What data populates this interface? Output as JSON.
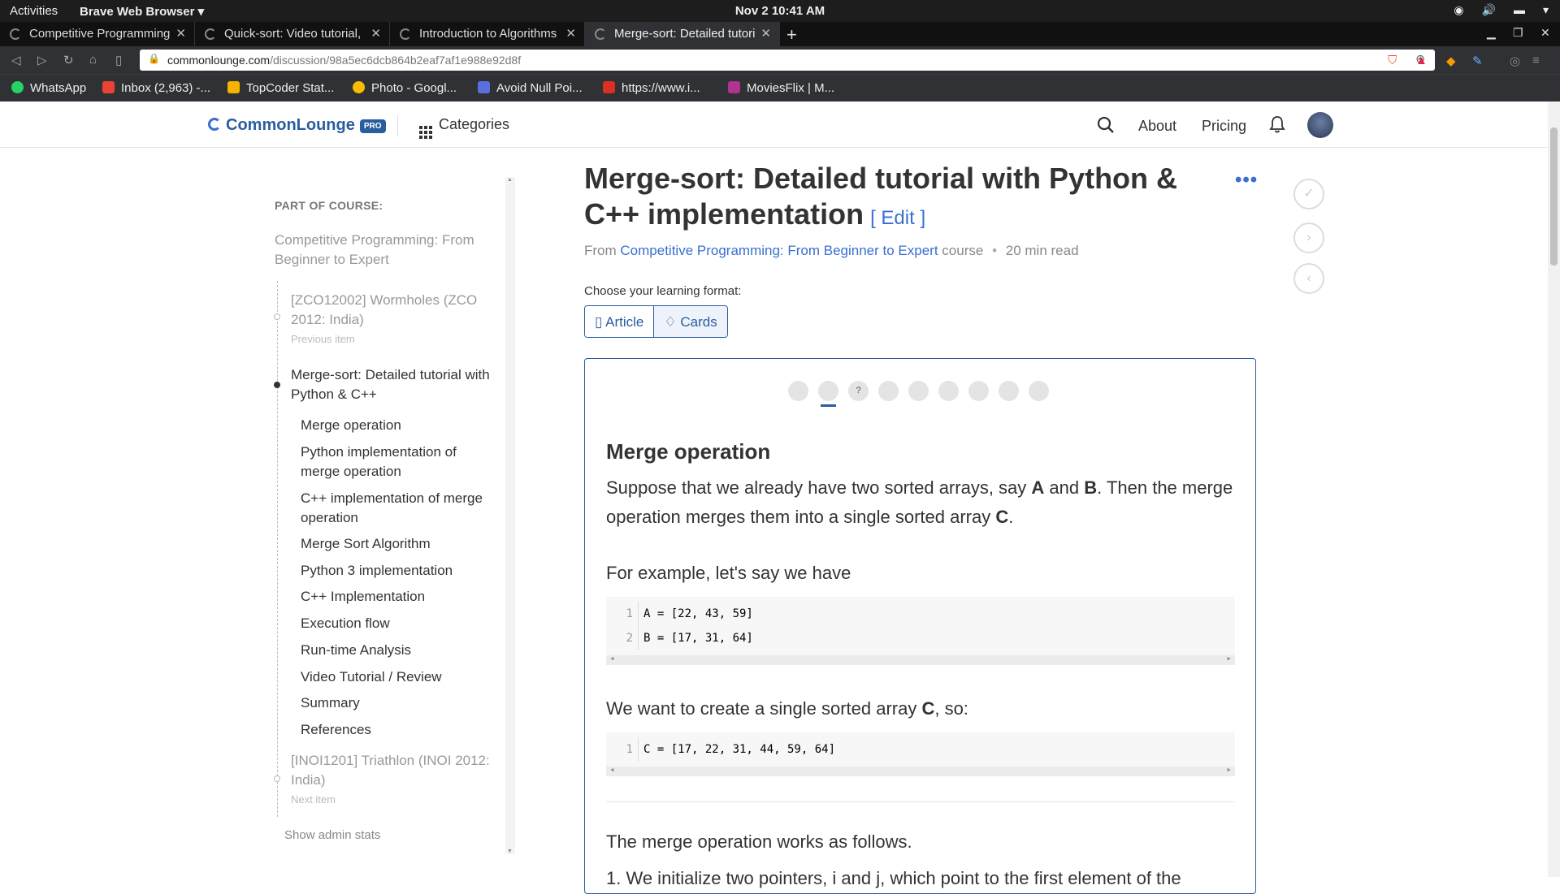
{
  "system": {
    "activities": "Activities",
    "app_menu": "Brave Web Browser ▾",
    "clock": "Nov 2  10:41 AM"
  },
  "tabs": [
    {
      "label": "Competitive Programming"
    },
    {
      "label": "Quick-sort: Video tutorial,"
    },
    {
      "label": "Introduction to Algorithms"
    },
    {
      "label": "Merge-sort: Detailed tutori"
    }
  ],
  "address_bar": {
    "url_domain": "commonlounge.com",
    "url_path": "/discussion/98a5ec6dcb864b2eaf7af1e988e92d8f"
  },
  "bookmarks": [
    {
      "label": "WhatsApp",
      "color": "#25d366"
    },
    {
      "label": "Inbox (2,963) -...",
      "color": "#ea4335"
    },
    {
      "label": "TopCoder Stat...",
      "color": "#f5b400"
    },
    {
      "label": "Photo - Googl...",
      "color": "#fbbc05"
    },
    {
      "label": "Avoid Null Poi...",
      "color": "#5a6ee0"
    },
    {
      "label": "https://www.i...",
      "color": "#d93025"
    },
    {
      "label": "MoviesFlix | M...",
      "color": "#b0338f"
    }
  ],
  "site_header": {
    "logo": "CommonLounge",
    "pro_badge": "PRO",
    "categories": "Categories",
    "about": "About",
    "pricing": "Pricing"
  },
  "sidebar": {
    "part_of_course_label": "PART OF COURSE:",
    "course_title": "Competitive Programming: From Beginner to Expert",
    "previous_item": {
      "title": "[ZCO12002] Wormholes (ZCO 2012: India)",
      "caption": "Previous item"
    },
    "current_item": {
      "title": "Merge-sort: Detailed tutorial with Python & C++"
    },
    "sections": [
      "Merge operation",
      "Python implementation of merge operation",
      "C++ implementation of merge operation",
      "Merge Sort Algorithm",
      "Python 3 implementation",
      "C++ Implementation",
      "Execution flow",
      "Run-time Analysis",
      "Video Tutorial / Review",
      "Summary",
      "References"
    ],
    "next_item": {
      "title": "[INOI1201] Triathlon (INOI 2012: India)",
      "caption": "Next item"
    },
    "admin_stats": "Show admin stats"
  },
  "article": {
    "title": "Merge-sort: Detailed tutorial with Python & C++ implementation",
    "edit_label": "[ Edit ]",
    "meta_from": "From",
    "meta_course": "Competitive Programming: From Beginner to Expert",
    "meta_course_suffix": "course",
    "meta_read_time": "20 min read",
    "choose_format": "Choose your learning format:",
    "format_article": "Article",
    "format_cards": "Cards"
  },
  "card": {
    "progress_dots": [
      "",
      "",
      "?",
      "",
      "",
      "",
      "",
      "",
      ""
    ],
    "current_dot": 1,
    "section_title": "Merge operation",
    "para1_pre": "Suppose that we already have two sorted arrays, say ",
    "para1_a": "A",
    "para1_and": " and ",
    "para1_b": "B",
    "para1_mid": ". Then the merge operation merges them into a single sorted array ",
    "para1_c": "C",
    "para1_end": ".",
    "para2": "For example, let's say we have",
    "code1": [
      {
        "ln": "1",
        "code": "A = [22, 43, 59]"
      },
      {
        "ln": "2",
        "code": "B = [17, 31, 64]"
      }
    ],
    "para3_pre": "We want to create a single sorted array ",
    "para3_c": "C",
    "para3_end": ", so:",
    "code2": [
      {
        "ln": "1",
        "code": "C = [17, 22, 31, 44, 59, 64]"
      }
    ],
    "para4": "The merge operation works as follows.",
    "para5": "1. We initialize two pointers, i and j, which point to the first element of the"
  }
}
